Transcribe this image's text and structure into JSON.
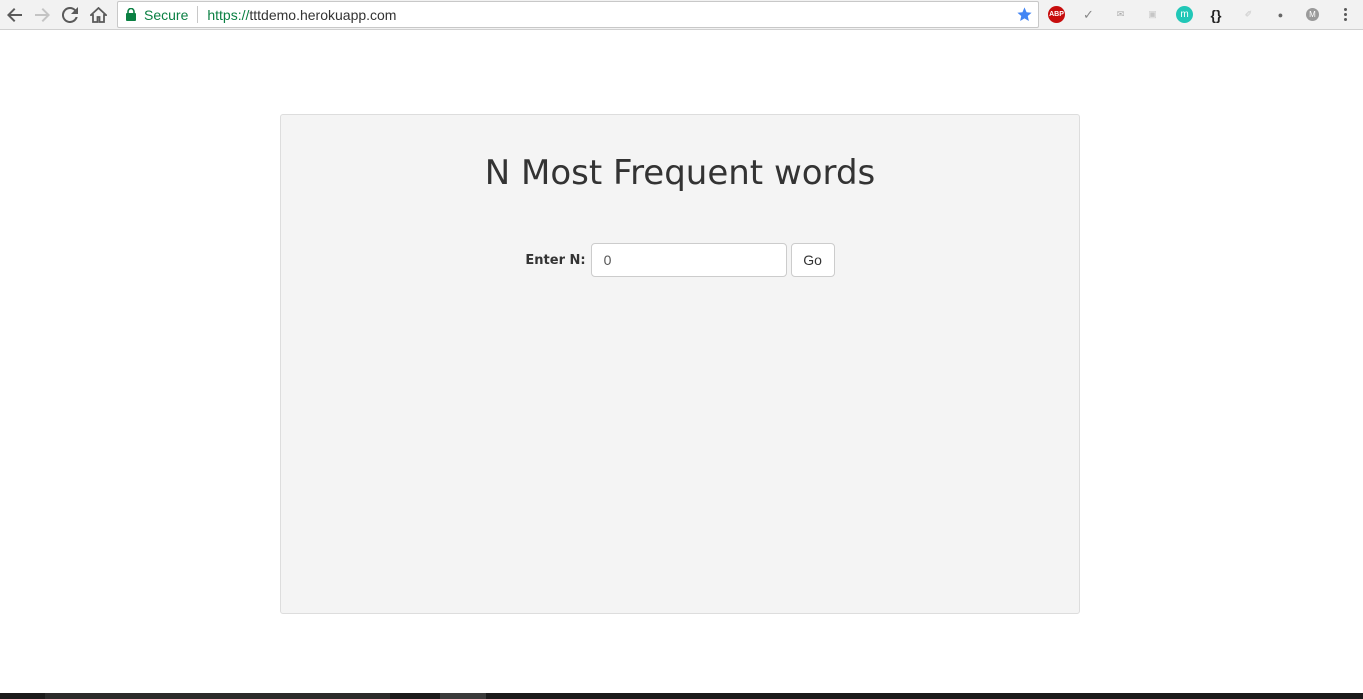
{
  "browser": {
    "security_label": "Secure",
    "url_scheme": "https://",
    "url_host": "tttdemo.herokuapp.com",
    "extensions": [
      {
        "name": "adblock-plus-icon",
        "text": "ABP"
      },
      {
        "name": "check-icon",
        "text": "✓"
      },
      {
        "name": "tray-icon",
        "text": "✉"
      },
      {
        "name": "chat-icon",
        "text": "▣"
      },
      {
        "name": "m-icon",
        "text": "m"
      },
      {
        "name": "braces-icon",
        "text": "{}"
      },
      {
        "name": "pdf-icon",
        "text": "✐"
      },
      {
        "name": "drops-icon",
        "text": "●"
      },
      {
        "name": "m-gray-icon",
        "text": "M"
      }
    ],
    "accent_colors": {
      "secure": "#0b8043",
      "star": "#4285f4"
    }
  },
  "page": {
    "title": "N Most Frequent words",
    "form": {
      "label": "Enter N:",
      "input_value": "0",
      "button_label": "Go"
    }
  }
}
